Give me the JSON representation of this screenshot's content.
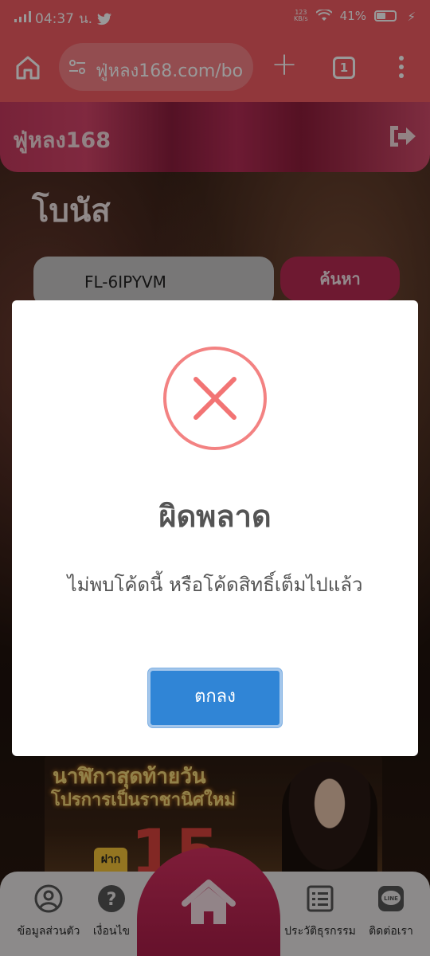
{
  "status_bar": {
    "time": "04:37",
    "time_suffix": "น.",
    "net_speed_value": "123",
    "net_speed_unit": "KB/s",
    "battery": "41%"
  },
  "browser": {
    "url": "ฟู่หลง168.com/bo",
    "tab_count": "1"
  },
  "site": {
    "title": "ฟู่หลง168",
    "page_heading": "โบนัส",
    "code_input_value": "FL-6IPYVM",
    "search_label": "ค้นหา"
  },
  "promo": {
    "line1": "นาฬิกาสุดท้ายวัน",
    "line2": "โปรการเป็นราชานิศใหม่",
    "number": "15",
    "badge": "ฝาก"
  },
  "bottom_nav": {
    "items": [
      {
        "label": "ข้อมูลส่วนตัว",
        "icon": "user-circle-icon"
      },
      {
        "label": "เงื่อนไข",
        "icon": "question-icon"
      },
      {
        "label": "",
        "icon": "home-icon"
      },
      {
        "label": "ประวัติธุรกรรม",
        "icon": "list-icon"
      },
      {
        "label": "ติดต่อเรา",
        "icon": "line-icon"
      }
    ]
  },
  "modal": {
    "title": "ผิดพลาด",
    "message": "ไม่พบโค้ดนี้ หรือโค้ดสิทธิ์เต็มไปแล้ว",
    "ok_label": "ตกลง",
    "icon": "error-x-icon"
  },
  "colors": {
    "browser_bar": "#f25d63",
    "error_red": "#f27474",
    "ok_button": "#3085d6",
    "header_accent": "#b72a52"
  }
}
